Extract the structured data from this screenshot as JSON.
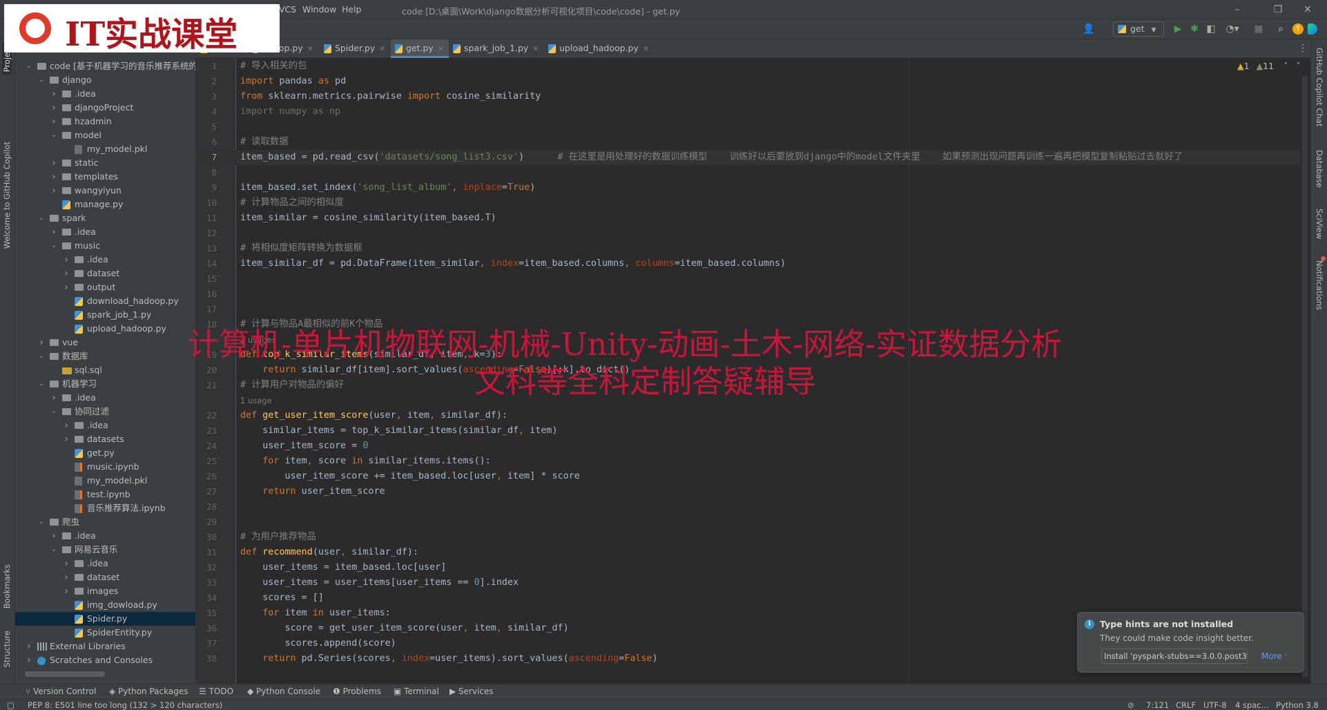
{
  "titlebar": {
    "menus": [
      "VCS",
      "Window",
      "Help"
    ],
    "title": "code [D:\\桌面\\Work\\django数据分析可视化项目\\code\\code] - get.py",
    "controls": [
      "–",
      "❐",
      "✕"
    ]
  },
  "toolbar": {
    "run_config": "get"
  },
  "logo": {
    "text": "IT实战课堂"
  },
  "left_strip": [
    "Project",
    "Welcome to GitHub Copilot",
    "Bookmarks",
    "Structure"
  ],
  "right_strip": [
    "GitHub Copilot Chat",
    "Database",
    "SciView",
    "Notifications"
  ],
  "tabs": [
    {
      "label": "download_hadoop.py",
      "active": false
    },
    {
      "label": "Spider.py",
      "active": false
    },
    {
      "label": "get.py",
      "active": true
    },
    {
      "label": "spark_job_1.py",
      "active": false
    },
    {
      "label": "upload_hadoop.py",
      "active": false
    }
  ],
  "tree": [
    {
      "label": "code [基于机器学习的音乐推荐系统的设",
      "depth": 0,
      "type": "folder",
      "exp": "open"
    },
    {
      "label": "django",
      "depth": 1,
      "type": "folder",
      "exp": "open"
    },
    {
      "label": ".idea",
      "depth": 2,
      "type": "folder",
      "exp": "closed"
    },
    {
      "label": "djangoProject",
      "depth": 2,
      "type": "folder",
      "exp": "closed"
    },
    {
      "label": "hzadmin",
      "depth": 2,
      "type": "folder",
      "exp": "closed"
    },
    {
      "label": "model",
      "depth": 2,
      "type": "folder",
      "exp": "open"
    },
    {
      "label": "my_model.pkl",
      "depth": 3,
      "type": "pkl"
    },
    {
      "label": "static",
      "depth": 2,
      "type": "folder",
      "exp": "closed"
    },
    {
      "label": "templates",
      "depth": 2,
      "type": "folder",
      "exp": "closed"
    },
    {
      "label": "wangyiyun",
      "depth": 2,
      "type": "folder",
      "exp": "closed"
    },
    {
      "label": "manage.py",
      "depth": 2,
      "type": "py"
    },
    {
      "label": "spark",
      "depth": 1,
      "type": "folder",
      "exp": "open"
    },
    {
      "label": ".idea",
      "depth": 2,
      "type": "folder",
      "exp": "closed"
    },
    {
      "label": "music",
      "depth": 2,
      "type": "folder",
      "exp": "open"
    },
    {
      "label": ".idea",
      "depth": 3,
      "type": "folder",
      "exp": "closed"
    },
    {
      "label": "dataset",
      "depth": 3,
      "type": "folder",
      "exp": "closed"
    },
    {
      "label": "output",
      "depth": 3,
      "type": "folder",
      "exp": "closed"
    },
    {
      "label": "download_hadoop.py",
      "depth": 3,
      "type": "py"
    },
    {
      "label": "spark_job_1.py",
      "depth": 3,
      "type": "py"
    },
    {
      "label": "upload_hadoop.py",
      "depth": 3,
      "type": "py"
    },
    {
      "label": "vue",
      "depth": 1,
      "type": "folder",
      "exp": "closed"
    },
    {
      "label": "数据库",
      "depth": 1,
      "type": "folder",
      "exp": "open"
    },
    {
      "label": "sql.sql",
      "depth": 2,
      "type": "sql"
    },
    {
      "label": "机器学习",
      "depth": 1,
      "type": "folder",
      "exp": "open"
    },
    {
      "label": ".idea",
      "depth": 2,
      "type": "folder",
      "exp": "closed"
    },
    {
      "label": "协同过滤",
      "depth": 2,
      "type": "folder",
      "exp": "open"
    },
    {
      "label": ".idea",
      "depth": 3,
      "type": "folder",
      "exp": "closed"
    },
    {
      "label": "datasets",
      "depth": 3,
      "type": "folder",
      "exp": "closed"
    },
    {
      "label": "get.py",
      "depth": 3,
      "type": "py"
    },
    {
      "label": "music.ipynb",
      "depth": 3,
      "type": "ipynb"
    },
    {
      "label": "my_model.pkl",
      "depth": 3,
      "type": "pkl"
    },
    {
      "label": "test.ipynb",
      "depth": 3,
      "type": "ipynb"
    },
    {
      "label": "音乐推荐算法.ipynb",
      "depth": 3,
      "type": "ipynb"
    },
    {
      "label": "爬虫",
      "depth": 1,
      "type": "folder",
      "exp": "open"
    },
    {
      "label": ".idea",
      "depth": 2,
      "type": "folder",
      "exp": "closed"
    },
    {
      "label": "网易云音乐",
      "depth": 2,
      "type": "folder",
      "exp": "open"
    },
    {
      "label": ".idea",
      "depth": 3,
      "type": "folder",
      "exp": "closed"
    },
    {
      "label": "dataset",
      "depth": 3,
      "type": "folder",
      "exp": "closed"
    },
    {
      "label": "images",
      "depth": 3,
      "type": "folder",
      "exp": "closed"
    },
    {
      "label": "img_dowload.py",
      "depth": 3,
      "type": "py"
    },
    {
      "label": "Spider.py",
      "depth": 3,
      "type": "py",
      "selected": true
    },
    {
      "label": "SpiderEntity.py",
      "depth": 3,
      "type": "py"
    },
    {
      "label": "External Libraries",
      "depth": 0,
      "type": "lib",
      "exp": "closed"
    },
    {
      "label": "Scratches and Consoles",
      "depth": 0,
      "type": "scratch",
      "exp": "closed"
    }
  ],
  "editor": {
    "inspections": {
      "warnings": "1",
      "weak_warnings": "11"
    },
    "current_line": "7",
    "rows": [
      {
        "n": "1",
        "tk": [
          [
            "c",
            "# 导入相关的包"
          ]
        ]
      },
      {
        "n": "2",
        "tk": [
          [
            "k",
            "import"
          ],
          [
            "t",
            " pandas "
          ],
          [
            "k",
            "as"
          ],
          [
            "t",
            " pd"
          ]
        ]
      },
      {
        "n": "3",
        "tk": [
          [
            "k",
            "from"
          ],
          [
            "t",
            " sklearn.metrics.pairwise "
          ],
          [
            "k",
            "import"
          ],
          [
            "t",
            " cosine_similarity"
          ]
        ]
      },
      {
        "n": "4",
        "tk": [
          [
            "u",
            "import numpy as np"
          ]
        ]
      },
      {
        "n": "5",
        "tk": []
      },
      {
        "n": "6",
        "tk": [
          [
            "c",
            "# 读取数据"
          ]
        ]
      },
      {
        "n": "7",
        "tk": [
          [
            "t",
            "item_based = pd.read_csv("
          ],
          [
            "s",
            "'datasets/song_list3.csv'"
          ],
          [
            "t",
            ")      "
          ],
          [
            "c",
            "# 在这里是用处理好的数据训练模型    训练好以后要放到django中的model文件夹里    如果预测出现问题再训练一遍再把模型复制粘贴过去就好了"
          ]
        ]
      },
      {
        "n": "8",
        "tk": []
      },
      {
        "n": "9",
        "tk": [
          [
            "t",
            "item_based.set_index("
          ],
          [
            "s",
            "'song_list_album'"
          ],
          [
            "k",
            ", "
          ],
          [
            "p",
            "inplace"
          ],
          [
            "t",
            "="
          ],
          [
            "k",
            "True"
          ],
          [
            "t",
            ")"
          ]
        ]
      },
      {
        "n": "10",
        "tk": [
          [
            "c",
            "# 计算物品之间的相似度"
          ]
        ]
      },
      {
        "n": "11",
        "tk": [
          [
            "t",
            "item_similar = cosine_similarity(item_based.T)"
          ]
        ]
      },
      {
        "n": "12",
        "tk": []
      },
      {
        "n": "13",
        "tk": [
          [
            "c",
            "# 将相似度矩阵转换为数据框"
          ]
        ]
      },
      {
        "n": "14",
        "tk": [
          [
            "t",
            "item_similar_df = pd.DataFrame(item_similar"
          ],
          [
            "k",
            ", "
          ],
          [
            "p",
            "index"
          ],
          [
            "t",
            "=item_based.columns"
          ],
          [
            "k",
            ", "
          ],
          [
            "p",
            "columns"
          ],
          [
            "t",
            "=item_based.columns)"
          ]
        ]
      },
      {
        "n": "15",
        "tk": []
      },
      {
        "n": "16",
        "tk": []
      },
      {
        "n": "17",
        "tk": []
      },
      {
        "n": "18",
        "tk": [
          [
            "c",
            "# 计算与物品A最相似的前K个物品"
          ]
        ]
      },
      {
        "hint": "2 usages"
      },
      {
        "n": "19",
        "tk": [
          [
            "k",
            "def "
          ],
          [
            "f",
            "top_k_similar_items"
          ],
          [
            "t",
            "(similar_df"
          ],
          [
            "k",
            ", "
          ],
          [
            "t",
            "item"
          ],
          [
            "k",
            ", "
          ],
          [
            "t",
            "k="
          ],
          [
            "n",
            "3"
          ],
          [
            "t",
            "):"
          ]
        ]
      },
      {
        "n": "20",
        "tk": [
          [
            "t",
            "    "
          ],
          [
            "k",
            "return"
          ],
          [
            "t",
            " similar_df[item].sort_values("
          ],
          [
            "p",
            "ascending"
          ],
          [
            "t",
            "="
          ],
          [
            "k",
            "False"
          ],
          [
            "t",
            ")[:k].to_dict()"
          ]
        ]
      },
      {
        "n": "21",
        "tk": [
          [
            "c",
            "# 计算用户对物品的偏好"
          ]
        ]
      },
      {
        "hint": "1 usage"
      },
      {
        "n": "22",
        "tk": [
          [
            "k",
            "def "
          ],
          [
            "f",
            "get_user_item_score"
          ],
          [
            "t",
            "(user"
          ],
          [
            "k",
            ", "
          ],
          [
            "t",
            "item"
          ],
          [
            "k",
            ", "
          ],
          [
            "t",
            "similar_df):"
          ]
        ]
      },
      {
        "n": "23",
        "tk": [
          [
            "t",
            "    similar_items = top_k_similar_items(similar_df"
          ],
          [
            "k",
            ", "
          ],
          [
            "t",
            "item)"
          ]
        ]
      },
      {
        "n": "24",
        "tk": [
          [
            "t",
            "    user_item_score = "
          ],
          [
            "n",
            "0"
          ]
        ]
      },
      {
        "n": "25",
        "tk": [
          [
            "t",
            "    "
          ],
          [
            "k",
            "for"
          ],
          [
            "t",
            " item"
          ],
          [
            "k",
            ", "
          ],
          [
            "t",
            "score "
          ],
          [
            "k",
            "in"
          ],
          [
            "t",
            " similar_items.items():"
          ]
        ]
      },
      {
        "n": "26",
        "tk": [
          [
            "t",
            "        user_item_score += item_based.loc[user"
          ],
          [
            "k",
            ", "
          ],
          [
            "t",
            "item] * score"
          ]
        ]
      },
      {
        "n": "27",
        "tk": [
          [
            "t",
            "    "
          ],
          [
            "k",
            "return"
          ],
          [
            "t",
            " user_item_score"
          ]
        ]
      },
      {
        "n": "28",
        "tk": []
      },
      {
        "n": "29",
        "tk": []
      },
      {
        "n": "30",
        "tk": [
          [
            "c",
            "# 为用户推荐物品"
          ]
        ]
      },
      {
        "n": "31",
        "tk": [
          [
            "k",
            "def "
          ],
          [
            "f",
            "recommend"
          ],
          [
            "t",
            "(user"
          ],
          [
            "k",
            ", "
          ],
          [
            "t",
            "similar_df):"
          ]
        ]
      },
      {
        "n": "32",
        "tk": [
          [
            "t",
            "    user_items = item_based.loc[user]"
          ]
        ]
      },
      {
        "n": "33",
        "tk": [
          [
            "t",
            "    user_items = user_items[user_items == "
          ],
          [
            "n",
            "0"
          ],
          [
            "t",
            "].index"
          ]
        ]
      },
      {
        "n": "34",
        "tk": [
          [
            "t",
            "    scores = []"
          ]
        ]
      },
      {
        "n": "35",
        "tk": [
          [
            "t",
            "    "
          ],
          [
            "k",
            "for"
          ],
          [
            "t",
            " item "
          ],
          [
            "k",
            "in"
          ],
          [
            "t",
            " user_items:"
          ]
        ]
      },
      {
        "n": "36",
        "tk": [
          [
            "t",
            "        score = get_user_item_score(user"
          ],
          [
            "k",
            ", "
          ],
          [
            "t",
            "item"
          ],
          [
            "k",
            ", "
          ],
          [
            "t",
            "similar_df)"
          ]
        ]
      },
      {
        "n": "37",
        "tk": [
          [
            "t",
            "        scores.append(score)"
          ]
        ]
      },
      {
        "n": "38",
        "tk": [
          [
            "t",
            "    "
          ],
          [
            "k",
            "return"
          ],
          [
            "t",
            " pd.Series(scores"
          ],
          [
            "k",
            ", "
          ],
          [
            "p",
            "index"
          ],
          [
            "t",
            "=user_items).sort_values("
          ],
          [
            "p",
            "ascending"
          ],
          [
            "t",
            "="
          ],
          [
            "k",
            "False"
          ],
          [
            "t",
            ")"
          ]
        ]
      }
    ]
  },
  "watermark": {
    "line1": "计算机-单片机物联网-机械-Unity-动画-土木-网络-实证数据分析",
    "line2": "文科等全科定制答疑辅导"
  },
  "notification": {
    "title": "Type hints are not installed",
    "body": "They could make code insight better.",
    "action": "Install 'pyspark-stubs==3.0.0.post3'",
    "more": "More"
  },
  "bottom_tools": [
    "Version Control",
    "Python Packages",
    "TODO",
    "Python Console",
    "Problems",
    "Terminal",
    "Services"
  ],
  "status": {
    "message": "PEP 8: E501 line too long (132 > 120 characters)",
    "position": "7:121",
    "line_sep": "CRLF",
    "encoding": "UTF-8",
    "indent": "4 spac...",
    "interpreter": "Python 3.8"
  },
  "colors": {
    "accent": "#4a88c7",
    "keyword": "#cc7832",
    "string": "#6a8759",
    "watermark": "#d8143c"
  }
}
